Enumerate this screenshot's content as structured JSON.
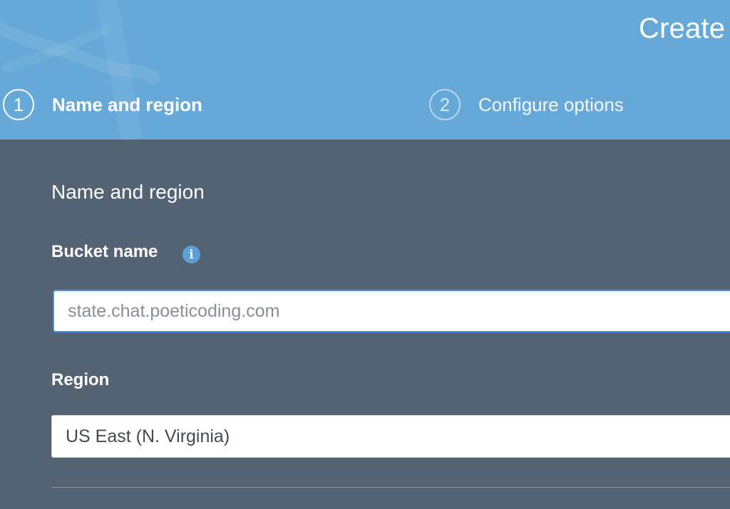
{
  "header": {
    "title": "Create"
  },
  "steps": [
    {
      "number": "1",
      "label": "Name and region"
    },
    {
      "number": "2",
      "label": "Configure options"
    }
  ],
  "form": {
    "section_title": "Name and region",
    "bucket_label": "Bucket name",
    "bucket_value": "state.chat.poeticoding.com",
    "region_label": "Region",
    "region_value": "US East (N. Virginia)"
  },
  "icons": {
    "info": "info-icon",
    "info_glyph": "i"
  },
  "colors": {
    "header_bg": "#66a8d8",
    "body_bg": "#546373",
    "input_focus_border": "#4a93d6",
    "info_icon": "#5a9fd6"
  }
}
